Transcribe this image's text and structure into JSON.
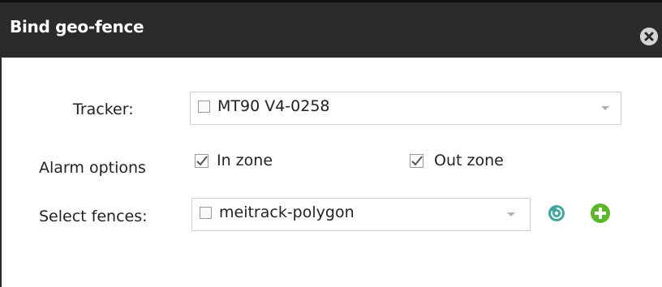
{
  "dialog": {
    "title": "Bind geo-fence"
  },
  "form": {
    "tracker_label": "Tracker:",
    "tracker_value": "MT90 V4-0258",
    "alarm_label": "Alarm options",
    "in_zone_label": "In zone",
    "in_zone_checked": true,
    "out_zone_label": "Out zone",
    "out_zone_checked": true,
    "fences_label": "Select fences:",
    "fences_value": "meitrack-polygon"
  },
  "colors": {
    "titlebar": "#2b2b2b",
    "refresh_icon": "#3fa7a0",
    "add_icon": "#5cb82a"
  },
  "icons": {
    "close": "close-icon",
    "refresh": "refresh-icon",
    "add": "add-icon"
  }
}
